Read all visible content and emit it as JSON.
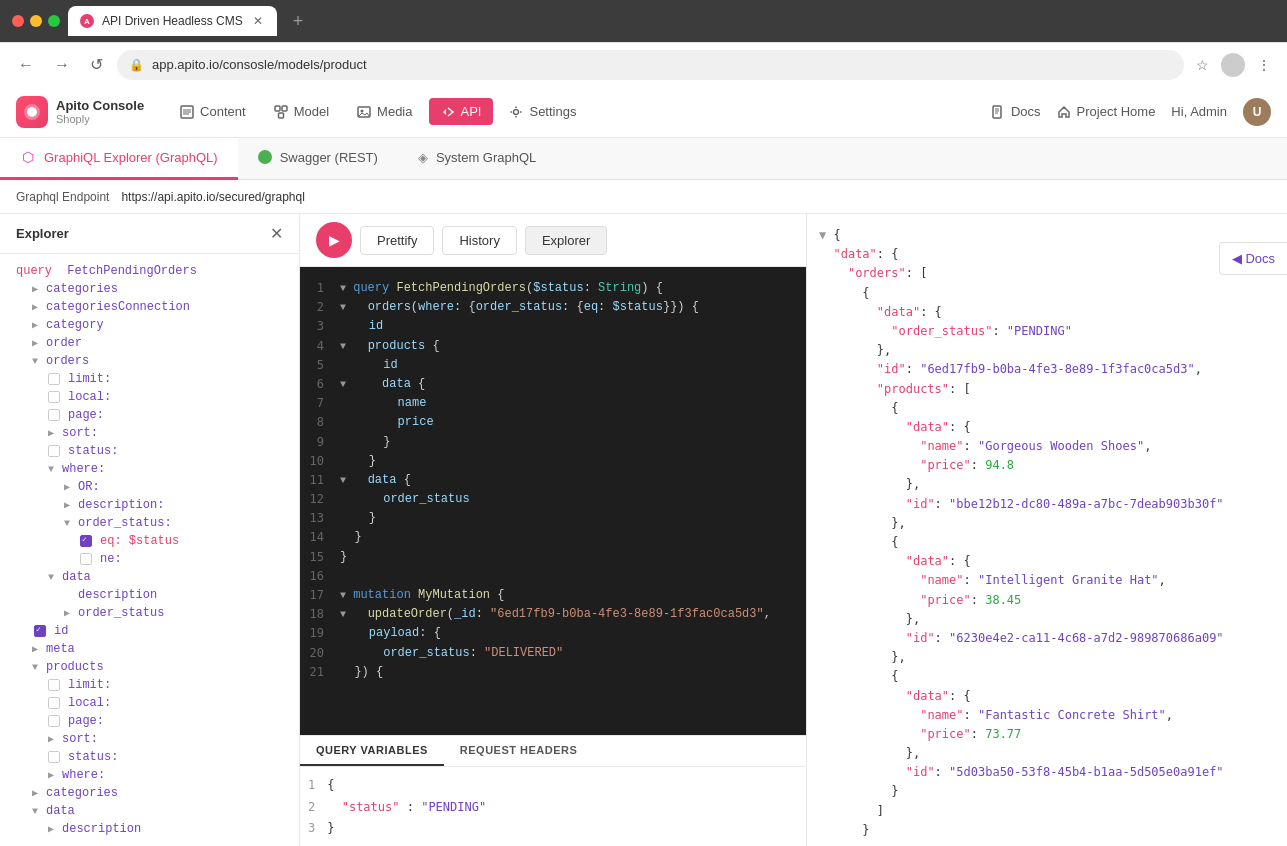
{
  "browser": {
    "tab_title": "API Driven Headless CMS",
    "url": "app.apito.io/consosle/models/product",
    "new_tab_btn": "+",
    "back_btn": "←",
    "forward_btn": "→",
    "refresh_btn": "↺"
  },
  "header": {
    "logo_text": "Apito Console",
    "logo_sub": "Shoply",
    "logo_initial": "A",
    "nav": {
      "content": "Content",
      "model": "Model",
      "media": "Media",
      "api": "API",
      "settings": "Settings"
    },
    "right": {
      "docs": "Docs",
      "project_home": "Project Home",
      "hi_admin": "Hi, Admin",
      "avatar_initial": "U"
    }
  },
  "api_tabs": [
    {
      "id": "graphql",
      "label": "GraphiQL Explorer (GraphQL)",
      "active": true
    },
    {
      "id": "swagger",
      "label": "Swagger (REST)",
      "active": false
    },
    {
      "id": "system",
      "label": "System GraphQL",
      "active": false
    }
  ],
  "endpoint": {
    "label": "Graphql Endpoint",
    "url": "https://api.apito.io/secured/graphql"
  },
  "explorer": {
    "title": "Explorer",
    "query_keyword": "query",
    "query_name": "FetchPendingOrders",
    "tree_items": [
      {
        "level": 1,
        "toggle": "▶",
        "label": "categories",
        "has_checkbox": false
      },
      {
        "level": 1,
        "toggle": "▶",
        "label": "categoriesConnection",
        "has_checkbox": false
      },
      {
        "level": 1,
        "toggle": "▶",
        "label": "category",
        "has_checkbox": false
      },
      {
        "level": 1,
        "toggle": "▶",
        "label": "order",
        "has_checkbox": false
      },
      {
        "level": 1,
        "toggle": "▼",
        "label": "orders",
        "has_checkbox": false,
        "expanded": true
      },
      {
        "level": 2,
        "toggle": "",
        "label": "limit:",
        "has_checkbox": true,
        "checked": false
      },
      {
        "level": 2,
        "toggle": "",
        "label": "local:",
        "has_checkbox": true,
        "checked": false
      },
      {
        "level": 2,
        "toggle": "",
        "label": "page:",
        "has_checkbox": true,
        "checked": false
      },
      {
        "level": 2,
        "toggle": "▶",
        "label": "sort:",
        "has_checkbox": false
      },
      {
        "level": 2,
        "toggle": "",
        "label": "status:",
        "has_checkbox": true,
        "checked": false
      },
      {
        "level": 2,
        "toggle": "▼",
        "label": "where:",
        "has_checkbox": false,
        "expanded": true
      },
      {
        "level": 3,
        "toggle": "▶",
        "label": "OR:",
        "has_checkbox": false
      },
      {
        "level": 3,
        "toggle": "▶",
        "label": "description:",
        "has_checkbox": false
      },
      {
        "level": 3,
        "toggle": "▼",
        "label": "order_status:",
        "has_checkbox": false,
        "expanded": true
      },
      {
        "level": 4,
        "toggle": "",
        "label": "eq: $status",
        "has_checkbox": true,
        "checked": true
      },
      {
        "level": 4,
        "toggle": "",
        "label": "ne:",
        "has_checkbox": true,
        "checked": false
      },
      {
        "level": 2,
        "toggle": "▼",
        "label": "data",
        "has_checkbox": false,
        "expanded": true
      },
      {
        "level": 3,
        "toggle": "",
        "label": "description",
        "has_checkbox": false
      },
      {
        "level": 3,
        "toggle": "▶",
        "label": "order_status",
        "has_checkbox": false
      },
      {
        "level": 1,
        "toggle": "",
        "label": "id",
        "has_checkbox": true,
        "checked": true
      },
      {
        "level": 1,
        "toggle": "▶",
        "label": "meta",
        "has_checkbox": false
      },
      {
        "level": 1,
        "toggle": "▼",
        "label": "products",
        "has_checkbox": false,
        "expanded": true
      },
      {
        "level": 2,
        "toggle": "",
        "label": "limit:",
        "has_checkbox": true,
        "checked": false
      },
      {
        "level": 2,
        "toggle": "",
        "label": "local:",
        "has_checkbox": true,
        "checked": false
      },
      {
        "level": 2,
        "toggle": "",
        "label": "page:",
        "has_checkbox": true,
        "checked": false
      },
      {
        "level": 2,
        "toggle": "▶",
        "label": "sort:",
        "has_checkbox": false
      },
      {
        "level": 2,
        "toggle": "",
        "label": "status:",
        "has_checkbox": true,
        "checked": false
      },
      {
        "level": 2,
        "toggle": "▶",
        "label": "where:",
        "has_checkbox": false
      },
      {
        "level": 1,
        "toggle": "▶",
        "label": "categories",
        "has_checkbox": false
      },
      {
        "level": 1,
        "toggle": "▼",
        "label": "data",
        "has_checkbox": false,
        "expanded": true
      },
      {
        "level": 2,
        "toggle": "▶",
        "label": "description",
        "has_checkbox": false
      }
    ]
  },
  "toolbar": {
    "run_icon": "▶",
    "prettify": "Prettify",
    "history": "History",
    "explorer": "Explorer"
  },
  "code_lines": [
    {
      "num": 1,
      "content": "query FetchPendingOrders($status: String) {"
    },
    {
      "num": 2,
      "content": "  orders(where: {order_status: {eq: $status}}) {"
    },
    {
      "num": 3,
      "content": "    id"
    },
    {
      "num": 4,
      "content": "    products {"
    },
    {
      "num": 5,
      "content": "      id"
    },
    {
      "num": 6,
      "content": "      data {"
    },
    {
      "num": 7,
      "content": "        name"
    },
    {
      "num": 8,
      "content": "        price"
    },
    {
      "num": 9,
      "content": "      }"
    },
    {
      "num": 10,
      "content": "    }"
    },
    {
      "num": 11,
      "content": "    data {"
    },
    {
      "num": 12,
      "content": "      order_status"
    },
    {
      "num": 13,
      "content": "    }"
    },
    {
      "num": 14,
      "content": "  }"
    },
    {
      "num": 15,
      "content": "}"
    },
    {
      "num": 16,
      "content": ""
    },
    {
      "num": 17,
      "content": "mutation MyMutation {"
    },
    {
      "num": 18,
      "content": "  updateOrder(_id: \"6ed17fb9-b0ba-4fe3-8e89-1f3fac0ca5d3\","
    },
    {
      "num": 19,
      "content": "    payload: {"
    },
    {
      "num": 20,
      "content": "      order_status: \"DELIVERED\""
    },
    {
      "num": 21,
      "content": "  }) {"
    }
  ],
  "query_variables": {
    "tabs": [
      "QUERY VARIABLES",
      "REQUEST HEADERS"
    ],
    "active_tab": "QUERY VARIABLES",
    "lines": [
      {
        "num": 1,
        "content": "{"
      },
      {
        "num": 2,
        "content": "  \"status\" : \"PENDING\""
      },
      {
        "num": 3,
        "content": "}"
      }
    ]
  },
  "results": {
    "lines": [
      "▼ {",
      "  \"data\": {",
      "    \"orders\": [",
      "      {",
      "        \"data\": {",
      "          \"order_status\": \"PENDING\"",
      "        },",
      "        \"id\": \"6ed17fb9-b0ba-4fe3-8e89-1f3fac0ca5d3\",",
      "        \"products\": [",
      "          {",
      "            \"data\": {",
      "              \"name\": \"Gorgeous Wooden Shoes\",",
      "              \"price\": 94.8",
      "            },",
      "            \"id\": \"bbe12b12-dc80-489a-a7bc-7deab903b30f\"",
      "          },",
      "          {",
      "            \"data\": {",
      "              \"name\": \"Intelligent Granite Hat\",",
      "              \"price\": 38.45",
      "            },",
      "            \"id\": \"6230e4e2-ca11-4c68-a7d2-989870686a09\"",
      "          },",
      "          {",
      "            \"data\": {",
      "              \"name\": \"Fantastic Concrete Shirt\",",
      "              \"price\": 73.77",
      "            },",
      "            \"id\": \"5d03ba50-53f8-45b4-b1aa-5d505e0a91ef\"",
      "          }",
      "        ]",
      "      }"
    ]
  },
  "docs_btn": "◀ Docs"
}
